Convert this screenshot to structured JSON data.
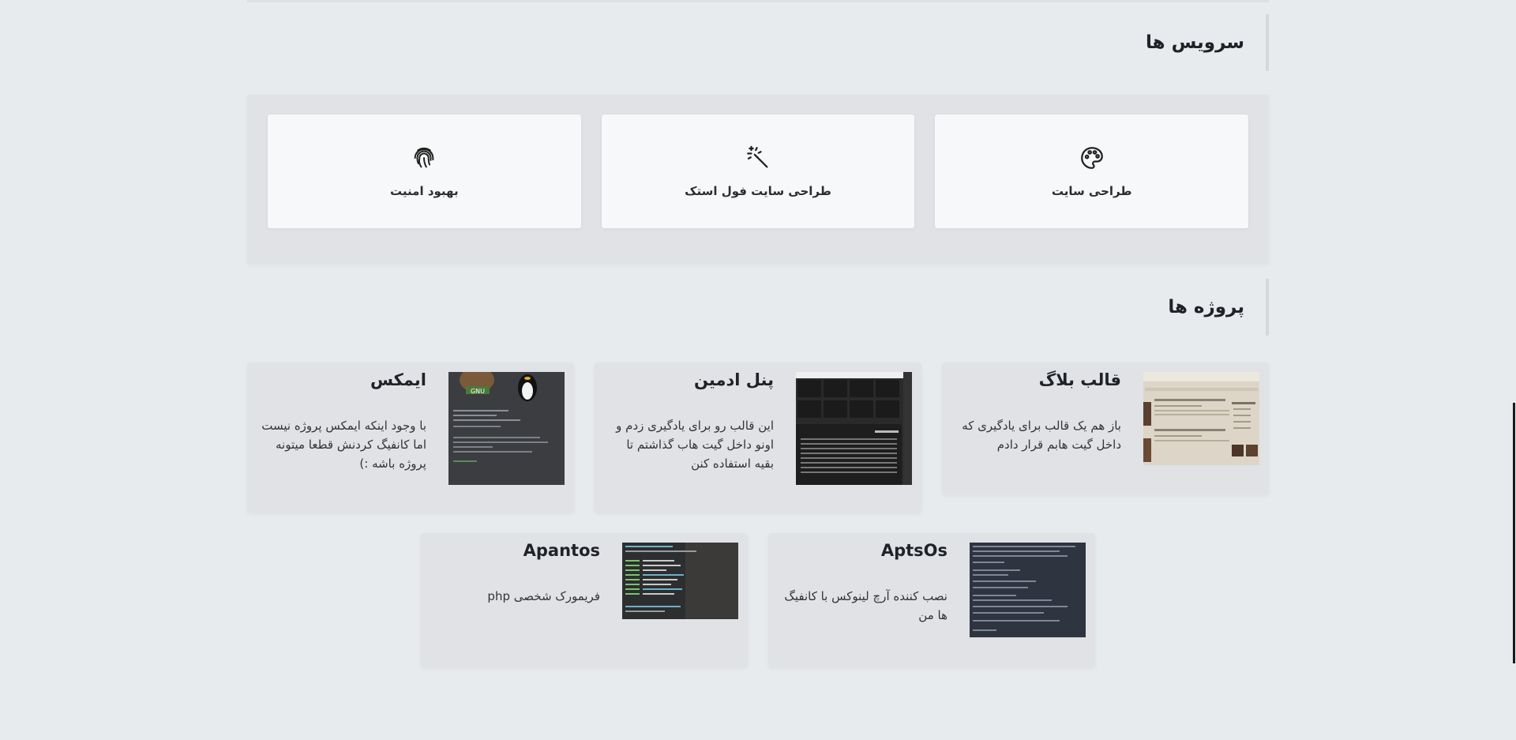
{
  "services": {
    "title": "سرویس ها",
    "items": [
      {
        "label": "طراحی سایت",
        "icon": "palette-icon"
      },
      {
        "label": "طراحی سایت فول استک",
        "icon": "magic-wand-icon"
      },
      {
        "label": "بهبود امنیت",
        "icon": "fingerprint-icon"
      }
    ]
  },
  "projects": {
    "title": "پروژه ها",
    "items": [
      {
        "title": "قالب بلاگ",
        "desc": "باز هم یک قالب برای یادگیری که داخل گیت هابم قرار دادم"
      },
      {
        "title": "پنل ادمین",
        "desc": "این قالب رو برای یادگیری زدم و اونو داخل گیت هاب گذاشتم تا بقیه استفاده کنن"
      },
      {
        "title": "ایمکس",
        "desc": "با وجود اینکه ایمکس پروژه نیست اما کانفیگ کردنش قطعا میتونه پروژه باشه :)"
      },
      {
        "title": "AptsOs",
        "desc": "نصب کننده آرچ لینوکس با کانفیگ ها من"
      },
      {
        "title": "Apantos",
        "desc": "فریمورک شخصی php"
      }
    ]
  },
  "thumb_labels": {
    "emacs_gnu": "GNU"
  },
  "colors": {
    "background": "#e8ebee",
    "panel": "#e0e2e6",
    "card": "#f7f8fa",
    "accent_border": "#d4d8dc"
  }
}
